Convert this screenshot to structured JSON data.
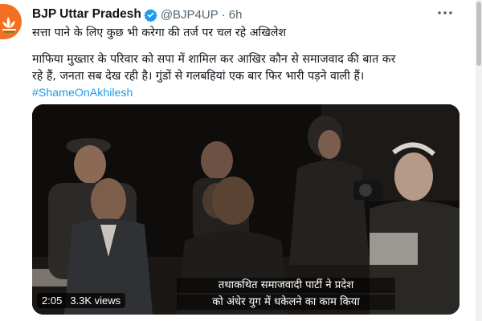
{
  "tweet": {
    "author_name": "BJP Uttar Pradesh",
    "handle": "@BJP4UP",
    "separator": "·",
    "time": "6h",
    "line1": "सत्ता पाने के लिए कुछ भी करेगा की तर्ज पर चल रहे अखिलेश",
    "line2": "माफिया मुख्तार के परिवार को सपा में शामिल कर आखिर कौन से समाजवाद की बात कर",
    "line3": "रहे हैं, जनता सब देख रही है। गुंडों से गलबहियां एक बार फिर भारी पड़ने वाली हैं।",
    "hashtag": "#ShameOnAkhilesh"
  },
  "video": {
    "subtitle_line1": "तथाकथित समाजवादी पार्टी ने प्रदेश",
    "subtitle_line2": "को अंधेर युग में धकेलने का काम किया",
    "duration": "2:05",
    "views": "3.3K views"
  },
  "icons": {
    "verified": "verified-badge-icon",
    "more": "more-options-icon",
    "avatar": "bjp-lotus-logo"
  },
  "colors": {
    "verified": "#1d9bf0",
    "hashtag": "#1d9bf0",
    "avatar_bg": "#f36f21",
    "secondary_text": "#536471"
  }
}
